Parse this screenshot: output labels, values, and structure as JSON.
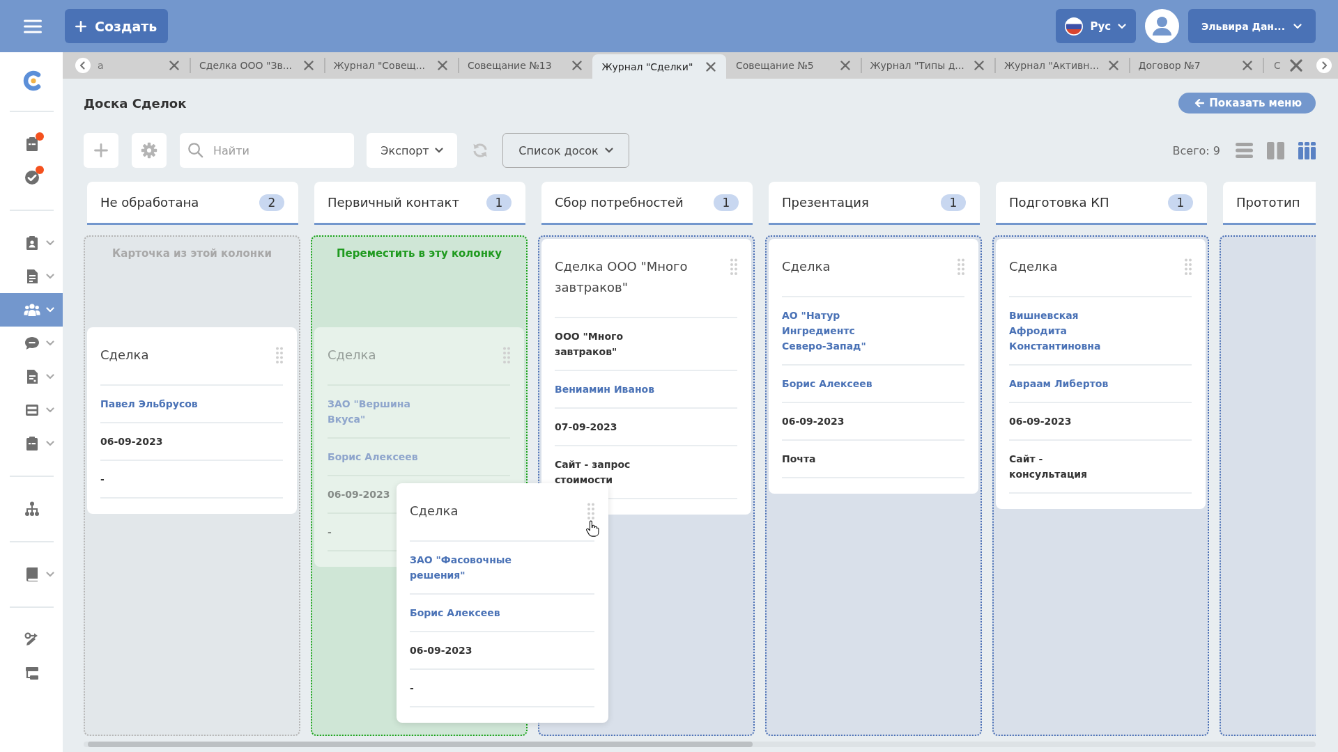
{
  "top_bar": {
    "create_button": "Создать",
    "language": "Рус",
    "user_name": "Эльвира Дан..."
  },
  "sidebar": {
    "groups": [
      {
        "items": [
          {
            "selected": false,
            "expandable": false,
            "alert": true
          },
          {
            "selected": false,
            "expandable": false,
            "alert": true
          }
        ]
      },
      {
        "items": [
          {
            "selected": false,
            "expandable": true,
            "alert": false
          },
          {
            "selected": false,
            "expandable": true,
            "alert": false
          },
          {
            "selected": true,
            "expandable": true,
            "alert": false
          },
          {
            "selected": false,
            "expandable": true,
            "alert": false
          },
          {
            "selected": false,
            "expandable": true,
            "alert": false
          },
          {
            "selected": false,
            "expandable": true,
            "alert": false
          },
          {
            "selected": false,
            "expandable": true,
            "alert": false
          }
        ]
      },
      {
        "items": [
          {
            "selected": false,
            "expandable": false,
            "alert": false
          }
        ]
      },
      {
        "items": [
          {
            "selected": false,
            "expandable": true,
            "alert": false
          }
        ]
      },
      {
        "items": [
          {
            "selected": false,
            "expandable": false,
            "alert": false
          },
          {
            "selected": false,
            "expandable": false,
            "alert": false
          }
        ]
      }
    ]
  },
  "tabs": [
    {
      "label": "а",
      "kind": "clipped_left",
      "selected": false
    },
    {
      "label": "Сделка ООО \"Зв...",
      "kind": "tab",
      "selected": false
    },
    {
      "label": "Журнал \"Совещ...",
      "kind": "tab",
      "selected": false
    },
    {
      "label": "Совещание №13",
      "kind": "tab",
      "selected": false
    },
    {
      "label": "Журнал \"Сделки\"",
      "kind": "tab",
      "selected": true
    },
    {
      "label": "Совещание №5",
      "kind": "tab",
      "selected": false
    },
    {
      "label": "Журнал \"Типы д...",
      "kind": "tab",
      "selected": false
    },
    {
      "label": "Журнал \"Активн...",
      "kind": "tab",
      "selected": false
    },
    {
      "label": "Договор №7",
      "kind": "tab",
      "selected": false
    },
    {
      "label": "С",
      "kind": "clipped_right",
      "selected": false
    }
  ],
  "page": {
    "title": "Доска Сделок",
    "show_menu_button": "Показать меню"
  },
  "toolbar": {
    "search": {
      "placeholder": "Найти"
    },
    "export_button": "Экспорт",
    "boards_dropdown": "Список досок",
    "total": "Всего: 9",
    "view_modes": [
      {
        "selected": false
      },
      {
        "selected": false
      },
      {
        "selected": true
      }
    ]
  },
  "board": {
    "columns": [
      {
        "title": "Не обработана",
        "count": "2",
        "kind": "source",
        "hint": "Карточка из этой колонки",
        "cards": [
          {
            "kind": "card",
            "title": "Сделка",
            "fields": [
              {
                "kind": "link",
                "text": "Павел Эльбрусов"
              },
              {
                "kind": "text",
                "text": "06-09-2023"
              },
              {
                "kind": "text",
                "text": "-"
              }
            ]
          }
        ]
      },
      {
        "title": "Первичный контакт",
        "count": "1",
        "kind": "target",
        "hint": "Переместить в эту колонку",
        "cards": [
          {
            "kind": "ghost",
            "title": "Сделка",
            "fields": [
              {
                "kind": "link",
                "text": "ЗАО \"Вершина Вкуса\""
              },
              {
                "kind": "link",
                "text": "Борис Алексеев"
              },
              {
                "kind": "text",
                "text": "06-09-2023"
              },
              {
                "kind": "text",
                "text": "-"
              }
            ]
          }
        ]
      },
      {
        "title": "Сбор потребностей",
        "count": "1",
        "kind": "normal",
        "cards": [
          {
            "kind": "card",
            "title": "Сделка ООО \"Много завтраков\"",
            "fields": [
              {
                "kind": "text",
                "text": "ООО \"Много завтраков\""
              },
              {
                "kind": "link",
                "text": "Вениамин Иванов"
              },
              {
                "kind": "text",
                "text": "07-09-2023"
              },
              {
                "kind": "text",
                "text": "Сайт - запрос стоимости"
              }
            ]
          }
        ]
      },
      {
        "title": "Презентация",
        "count": "1",
        "kind": "normal",
        "cards": [
          {
            "kind": "card",
            "title": "Сделка",
            "fields": [
              {
                "kind": "link",
                "text": "АО \"Натур Ингредиентс Северо-Запад\""
              },
              {
                "kind": "link",
                "text": "Борис Алексеев"
              },
              {
                "kind": "text",
                "text": "06-09-2023"
              },
              {
                "kind": "text",
                "text": "Почта"
              }
            ]
          }
        ]
      },
      {
        "title": "Подготовка КП",
        "count": "1",
        "kind": "normal",
        "cards": [
          {
            "kind": "card",
            "title": "Сделка",
            "fields": [
              {
                "kind": "link",
                "text": "Вишневская Афродита Константиновна"
              },
              {
                "kind": "link",
                "text": "Авраам Либертов"
              },
              {
                "kind": "text",
                "text": "06-09-2023"
              },
              {
                "kind": "text",
                "text": "Сайт - консультация"
              }
            ]
          }
        ]
      },
      {
        "title": "Прототип",
        "kind": "normal"
      }
    ]
  },
  "dragged_card": {
    "title": "Сделка",
    "fields": [
      {
        "kind": "link",
        "text": "ЗАО \"Фасовочные решения\""
      },
      {
        "kind": "link",
        "text": "Борис Алексеев"
      },
      {
        "kind": "text",
        "text": "06-09-2023"
      },
      {
        "kind": "text",
        "text": "-"
      }
    ]
  }
}
